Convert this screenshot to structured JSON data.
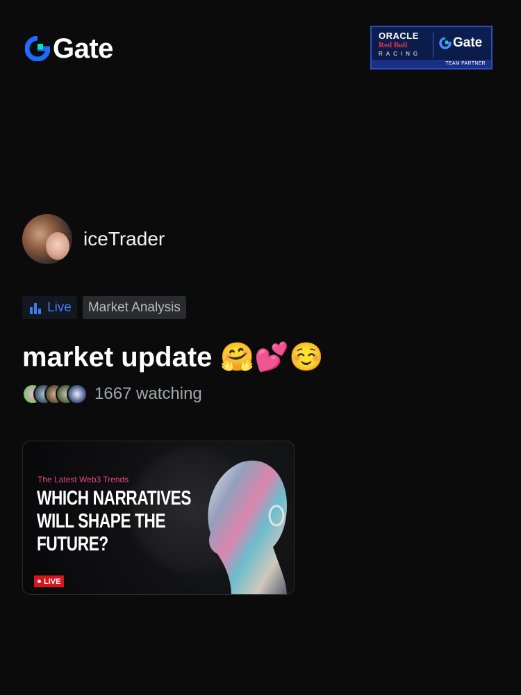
{
  "header": {
    "logo_text": "Gate",
    "logo_icon": "gate-logo-icon",
    "partner": {
      "oracle": "ORACLE",
      "redbull": "Red Bull",
      "racing": "RACING",
      "gate": "Gate",
      "strip": "TEAM PARTNER"
    }
  },
  "author": {
    "name": "iceTrader"
  },
  "tags": {
    "live": "Live",
    "category": "Market Analysis"
  },
  "title": "market update 🤗💕☺️",
  "watching": {
    "count_text": "1667 watching"
  },
  "thumbnail": {
    "kicker": "The Latest Web3 Trends",
    "headline": "WHICH NARRATIVES WILL SHAPE THE FUTURE?",
    "live_badge": "LIVE"
  },
  "colors": {
    "background": "#0b0b0c",
    "accent_blue": "#3d7cf5",
    "gate_green": "#00e6b4",
    "live_red": "#d6161d",
    "kicker_pink": "#e54a78"
  }
}
